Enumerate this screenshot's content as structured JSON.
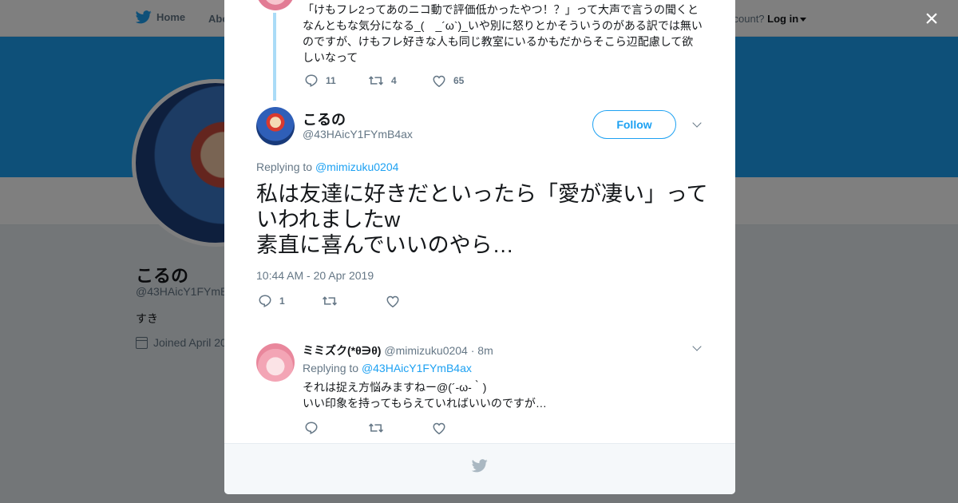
{
  "nav": {
    "home_label": "Home",
    "about_label": "Abo",
    "account_prompt": "ccount?",
    "login_label": "Log in"
  },
  "profile": {
    "name": "こるの",
    "handle": "@43HAicY1FYmB",
    "bio": "すき",
    "joined": "Joined April 20"
  },
  "previous_tweet": {
    "text": "「けもフレ2ってあのニコ動で評価低かったやつ！？」って大声で言うの聞くとなんともな気分になる_(　_´ω`)_いや別に怒りとかそういうのがある訳では無いのですが、けもフレ好きな人も同じ教室にいるかもだからそこら辺配慮して欲しいなって",
    "replies": "11",
    "retweets": "4",
    "likes": "65"
  },
  "main_tweet": {
    "name": "こるの",
    "handle": "@43HAicY1FYmB4ax",
    "follow_label": "Follow",
    "replying_prefix": "Replying to",
    "replying_to": "@mimizuku0204",
    "text": "私は友達に好きだといったら「愛が凄い」っていわれましたw\n素直に喜んでいいのやら…",
    "timestamp": "10:44 AM - 20 Apr 2019",
    "replies": "1",
    "retweets": "",
    "likes": ""
  },
  "reply_tweet": {
    "name": "ミミズク(*θ∋θ)",
    "handle": "@mimizuku0204",
    "time": "· 8m",
    "replying_prefix": "Replying to",
    "replying_to": "@43HAicY1FYmB4ax",
    "text": "それは捉え方悩みますねー@(´-ω-｀)\nいい印象を持ってもらえていればいいのですが…",
    "replies": "",
    "retweets": "",
    "likes": ""
  },
  "close_label": "×",
  "colors": {
    "brand_blue": "#1da1f2",
    "thread_line": "#aadbf7",
    "muted_text": "#657786"
  },
  "icons": [
    "twitter-bird-icon",
    "close-icon",
    "reply-icon",
    "retweet-icon",
    "like-icon",
    "chevron-down-icon",
    "calendar-icon"
  ]
}
